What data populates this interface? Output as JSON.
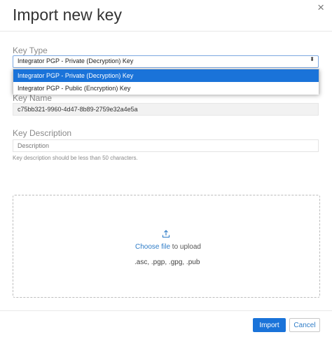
{
  "dialog": {
    "title": "Import new key",
    "close_icon": "×"
  },
  "key_type": {
    "label": "Key Type",
    "selected": "Integrator PGP - Private (Decryption) Key",
    "arrow_icon": "⬍",
    "options": [
      "Integrator PGP - Private (Decryption) Key",
      "Integrator PGP - Public (Encryption) Key"
    ]
  },
  "key_name": {
    "label": "Key Name",
    "value": "c75bb321-9960-4d47-8b89-2759e32a4e5a"
  },
  "key_description": {
    "label": "Key Description",
    "placeholder": "Description",
    "hint": "Key description should be less than 50 characters."
  },
  "upload": {
    "icon": "upload-icon",
    "choose_link": "Choose file",
    "to_upload": " to upload",
    "extensions": ".asc, .pgp, .gpg, .pub"
  },
  "footer": {
    "import_label": "Import",
    "cancel_label": "Cancel"
  },
  "colors": {
    "primary": "#1a73d9",
    "link": "#2e7cc7",
    "label": "#8a8a8a"
  }
}
